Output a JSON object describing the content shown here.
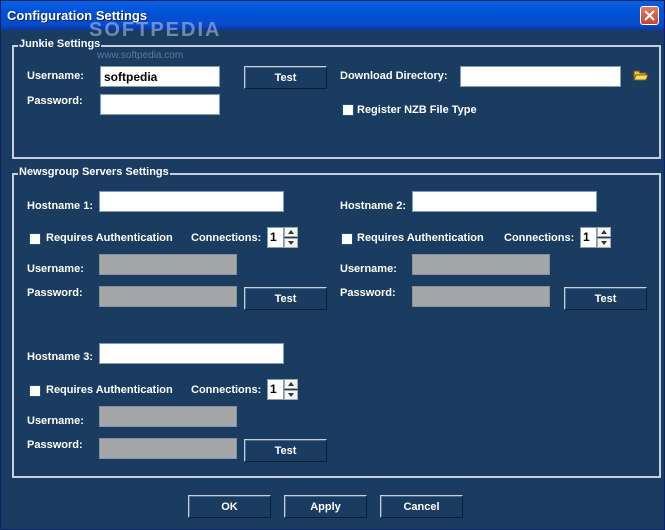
{
  "window": {
    "title": "Configuration Settings",
    "watermark": "SOFTPEDIA",
    "watermark_sub": "www.softpedia.com"
  },
  "junkie": {
    "legend": "Junkie Settings",
    "username_label": "Username:",
    "username_value": "softpedia",
    "password_label": "Password:",
    "password_value": "",
    "test_label": "Test",
    "download_label": "Download Directory:",
    "download_value": "",
    "register_label": "Register NZB File Type",
    "register_checked": false
  },
  "servers": {
    "legend": "Newsgroup Servers Settings",
    "items": [
      {
        "hostname_label": "Hostname 1:",
        "hostname_value": "",
        "auth_label": "Requires Authentication",
        "connections_label": "Connections:",
        "connections_value": "1",
        "username_label": "Username:",
        "password_label": "Password:",
        "test_label": "Test"
      },
      {
        "hostname_label": "Hostname 2:",
        "hostname_value": "",
        "auth_label": "Requires Authentication",
        "connections_label": "Connections:",
        "connections_value": "1",
        "username_label": "Username:",
        "password_label": "Password:",
        "test_label": "Test"
      },
      {
        "hostname_label": "Hostname 3:",
        "hostname_value": "",
        "auth_label": "Requires Authentication",
        "connections_label": "Connections:",
        "connections_value": "1",
        "username_label": "Username:",
        "password_label": "Password:",
        "test_label": "Test"
      }
    ]
  },
  "footer": {
    "ok_label": "OK",
    "apply_label": "Apply",
    "cancel_label": "Cancel"
  },
  "colors": {
    "background": "#193c60",
    "titlebar": "#0a5fe0",
    "border": "#c8d0dc"
  }
}
